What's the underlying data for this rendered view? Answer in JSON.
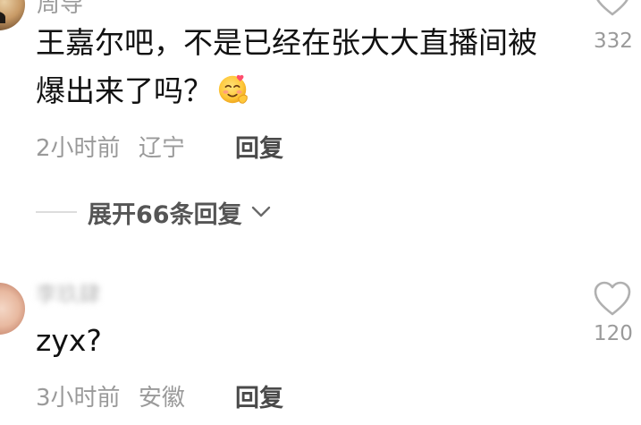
{
  "comments": [
    {
      "username": "周导",
      "text": "王嘉尔吧，不是已经在张大大直播间被爆出来了吗？",
      "emoji": "smiling-face-with-heart-hands",
      "time": "2小时前",
      "location": "辽宁",
      "reply_label": "回复",
      "like_count": "332",
      "expand_replies_label": "展开66条回复"
    },
    {
      "username": "李玖肆",
      "text": "zyx?",
      "time": "3小时前",
      "location": "安徽",
      "reply_label": "回复",
      "like_count": "120"
    }
  ],
  "icons": {
    "like": "heart-outline-icon",
    "expand": "chevron-down-icon"
  },
  "colors": {
    "text_primary": "#111111",
    "text_secondary": "#9a9a9a",
    "reply": "#4a4a4a",
    "icon": "#b0b0b0"
  }
}
